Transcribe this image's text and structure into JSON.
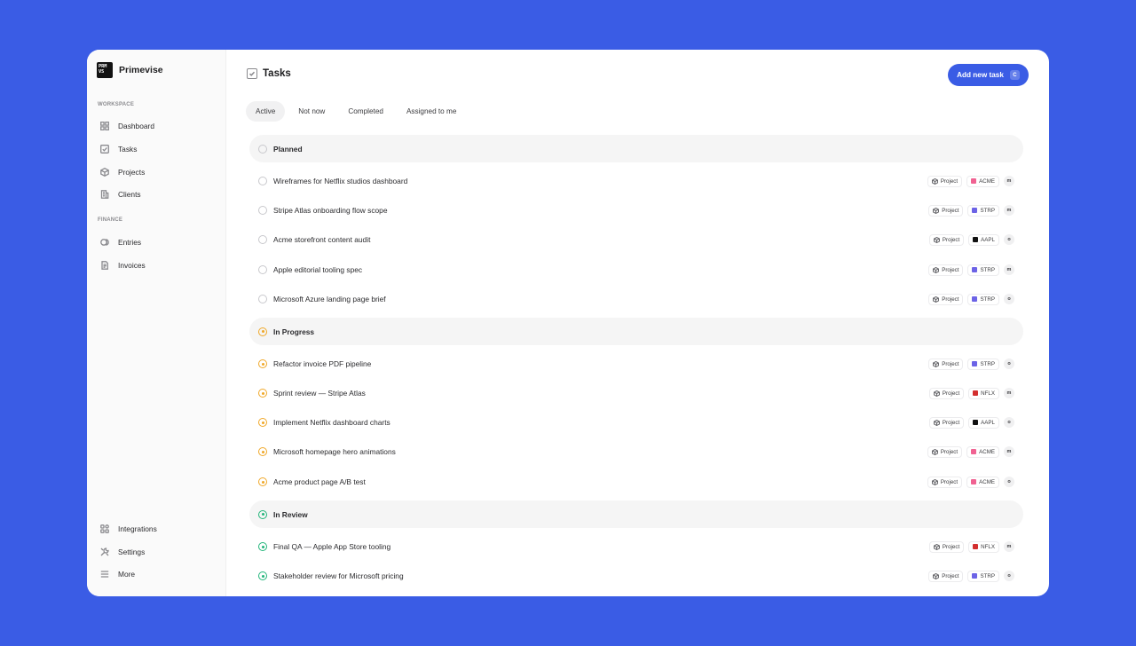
{
  "app": {
    "logo_line1": "PRM",
    "logo_line2": "VS",
    "name": "Primevise"
  },
  "sidebar": {
    "workspace_label": "WORKSPACE",
    "workspace_items": [
      {
        "label": "Dashboard",
        "icon": "grid-icon"
      },
      {
        "label": "Tasks",
        "icon": "checkbox-icon"
      },
      {
        "label": "Projects",
        "icon": "cube-icon"
      },
      {
        "label": "Clients",
        "icon": "building-icon"
      }
    ],
    "finance_label": "FINANCE",
    "finance_items": [
      {
        "label": "Entries",
        "icon": "coins-icon"
      },
      {
        "label": "Invoices",
        "icon": "document-icon"
      }
    ],
    "bottom_items": [
      {
        "label": "Integrations",
        "icon": "blocks-icon"
      },
      {
        "label": "Settings",
        "icon": "tools-icon"
      },
      {
        "label": "More",
        "icon": "menu-icon"
      }
    ]
  },
  "header": {
    "title": "Tasks",
    "add_button": "Add new task",
    "add_shortcut": "C"
  },
  "tabs": [
    "Active",
    "Not now",
    "Completed",
    "Assigned to me"
  ],
  "colors": {
    "accent": "#3a5ce5",
    "ACME": "#f06292",
    "STRP": "#6c63e6",
    "AAPL": "#111111",
    "NFLX": "#d32f2f",
    "progress": "#f0a828",
    "review": "#22b57a"
  },
  "groups": [
    {
      "name": "Planned",
      "status": "planned",
      "tasks": [
        {
          "title": "Wireframes for Netflix studios dashboard",
          "tag": "Project",
          "client": "ACME",
          "assignee": "m"
        },
        {
          "title": "Stripe Atlas onboarding flow scope",
          "tag": "Project",
          "client": "STRP",
          "assignee": "m"
        },
        {
          "title": "Acme storefront content audit",
          "tag": "Project",
          "client": "AAPL",
          "assignee": "o"
        },
        {
          "title": "Apple editorial tooling spec",
          "tag": "Project",
          "client": "STRP",
          "assignee": "m"
        },
        {
          "title": "Microsoft Azure landing page brief",
          "tag": "Project",
          "client": "STRP",
          "assignee": "o"
        }
      ]
    },
    {
      "name": "In Progress",
      "status": "progress",
      "tasks": [
        {
          "title": "Refactor invoice PDF pipeline",
          "tag": "Project",
          "client": "STRP",
          "assignee": "o"
        },
        {
          "title": "Sprint review — Stripe Atlas",
          "tag": "Project",
          "client": "NFLX",
          "assignee": "m"
        },
        {
          "title": "Implement Netflix dashboard charts",
          "tag": "Project",
          "client": "AAPL",
          "assignee": "o"
        },
        {
          "title": "Microsoft homepage hero animations",
          "tag": "Project",
          "client": "ACME",
          "assignee": "m"
        },
        {
          "title": "Acme product page A/B test",
          "tag": "Project",
          "client": "ACME",
          "assignee": "o"
        }
      ]
    },
    {
      "name": "In Review",
      "status": "review",
      "tasks": [
        {
          "title": "Final QA — Apple App Store tooling",
          "tag": "Project",
          "client": "NFLX",
          "assignee": "m"
        },
        {
          "title": "Stakeholder review for Microsoft pricing",
          "tag": "Project",
          "client": "STRP",
          "assignee": "o"
        }
      ]
    }
  ]
}
